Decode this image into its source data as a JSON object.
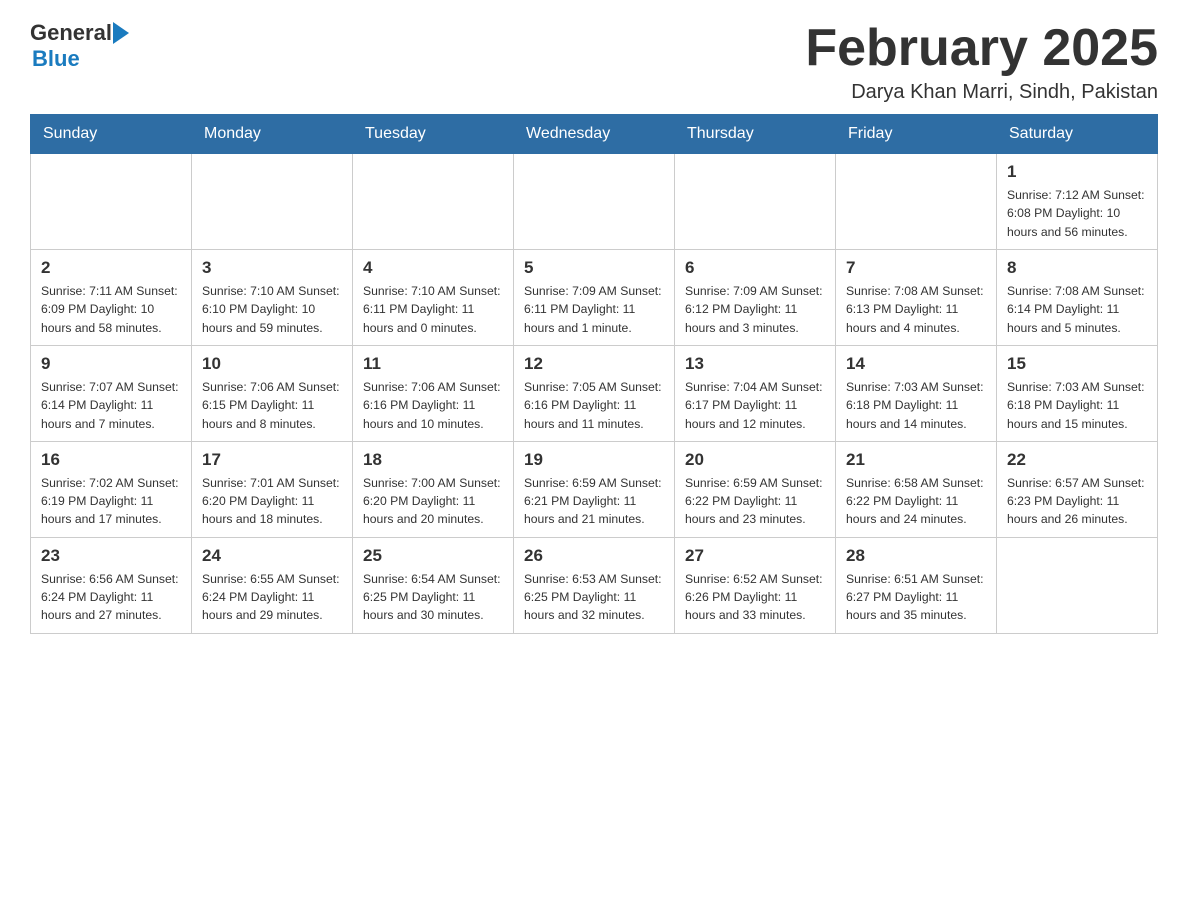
{
  "header": {
    "logo_general": "General",
    "logo_blue": "Blue",
    "title": "February 2025",
    "subtitle": "Darya Khan Marri, Sindh, Pakistan"
  },
  "days_of_week": [
    "Sunday",
    "Monday",
    "Tuesday",
    "Wednesday",
    "Thursday",
    "Friday",
    "Saturday"
  ],
  "weeks": [
    [
      {
        "day": "",
        "info": ""
      },
      {
        "day": "",
        "info": ""
      },
      {
        "day": "",
        "info": ""
      },
      {
        "day": "",
        "info": ""
      },
      {
        "day": "",
        "info": ""
      },
      {
        "day": "",
        "info": ""
      },
      {
        "day": "1",
        "info": "Sunrise: 7:12 AM\nSunset: 6:08 PM\nDaylight: 10 hours and 56 minutes."
      }
    ],
    [
      {
        "day": "2",
        "info": "Sunrise: 7:11 AM\nSunset: 6:09 PM\nDaylight: 10 hours and 58 minutes."
      },
      {
        "day": "3",
        "info": "Sunrise: 7:10 AM\nSunset: 6:10 PM\nDaylight: 10 hours and 59 minutes."
      },
      {
        "day": "4",
        "info": "Sunrise: 7:10 AM\nSunset: 6:11 PM\nDaylight: 11 hours and 0 minutes."
      },
      {
        "day": "5",
        "info": "Sunrise: 7:09 AM\nSunset: 6:11 PM\nDaylight: 11 hours and 1 minute."
      },
      {
        "day": "6",
        "info": "Sunrise: 7:09 AM\nSunset: 6:12 PM\nDaylight: 11 hours and 3 minutes."
      },
      {
        "day": "7",
        "info": "Sunrise: 7:08 AM\nSunset: 6:13 PM\nDaylight: 11 hours and 4 minutes."
      },
      {
        "day": "8",
        "info": "Sunrise: 7:08 AM\nSunset: 6:14 PM\nDaylight: 11 hours and 5 minutes."
      }
    ],
    [
      {
        "day": "9",
        "info": "Sunrise: 7:07 AM\nSunset: 6:14 PM\nDaylight: 11 hours and 7 minutes."
      },
      {
        "day": "10",
        "info": "Sunrise: 7:06 AM\nSunset: 6:15 PM\nDaylight: 11 hours and 8 minutes."
      },
      {
        "day": "11",
        "info": "Sunrise: 7:06 AM\nSunset: 6:16 PM\nDaylight: 11 hours and 10 minutes."
      },
      {
        "day": "12",
        "info": "Sunrise: 7:05 AM\nSunset: 6:16 PM\nDaylight: 11 hours and 11 minutes."
      },
      {
        "day": "13",
        "info": "Sunrise: 7:04 AM\nSunset: 6:17 PM\nDaylight: 11 hours and 12 minutes."
      },
      {
        "day": "14",
        "info": "Sunrise: 7:03 AM\nSunset: 6:18 PM\nDaylight: 11 hours and 14 minutes."
      },
      {
        "day": "15",
        "info": "Sunrise: 7:03 AM\nSunset: 6:18 PM\nDaylight: 11 hours and 15 minutes."
      }
    ],
    [
      {
        "day": "16",
        "info": "Sunrise: 7:02 AM\nSunset: 6:19 PM\nDaylight: 11 hours and 17 minutes."
      },
      {
        "day": "17",
        "info": "Sunrise: 7:01 AM\nSunset: 6:20 PM\nDaylight: 11 hours and 18 minutes."
      },
      {
        "day": "18",
        "info": "Sunrise: 7:00 AM\nSunset: 6:20 PM\nDaylight: 11 hours and 20 minutes."
      },
      {
        "day": "19",
        "info": "Sunrise: 6:59 AM\nSunset: 6:21 PM\nDaylight: 11 hours and 21 minutes."
      },
      {
        "day": "20",
        "info": "Sunrise: 6:59 AM\nSunset: 6:22 PM\nDaylight: 11 hours and 23 minutes."
      },
      {
        "day": "21",
        "info": "Sunrise: 6:58 AM\nSunset: 6:22 PM\nDaylight: 11 hours and 24 minutes."
      },
      {
        "day": "22",
        "info": "Sunrise: 6:57 AM\nSunset: 6:23 PM\nDaylight: 11 hours and 26 minutes."
      }
    ],
    [
      {
        "day": "23",
        "info": "Sunrise: 6:56 AM\nSunset: 6:24 PM\nDaylight: 11 hours and 27 minutes."
      },
      {
        "day": "24",
        "info": "Sunrise: 6:55 AM\nSunset: 6:24 PM\nDaylight: 11 hours and 29 minutes."
      },
      {
        "day": "25",
        "info": "Sunrise: 6:54 AM\nSunset: 6:25 PM\nDaylight: 11 hours and 30 minutes."
      },
      {
        "day": "26",
        "info": "Sunrise: 6:53 AM\nSunset: 6:25 PM\nDaylight: 11 hours and 32 minutes."
      },
      {
        "day": "27",
        "info": "Sunrise: 6:52 AM\nSunset: 6:26 PM\nDaylight: 11 hours and 33 minutes."
      },
      {
        "day": "28",
        "info": "Sunrise: 6:51 AM\nSunset: 6:27 PM\nDaylight: 11 hours and 35 minutes."
      },
      {
        "day": "",
        "info": ""
      }
    ]
  ]
}
